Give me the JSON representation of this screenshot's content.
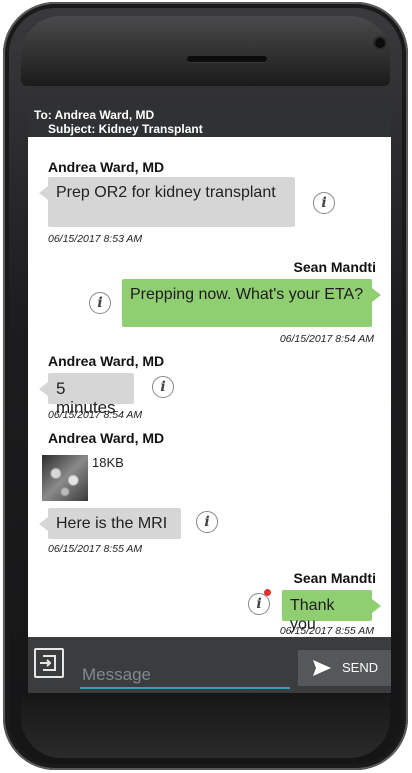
{
  "header": {
    "to": "To: Andrea Ward, MD",
    "subject": "Subject: Kidney Transplant"
  },
  "messages": [
    {
      "sender": "Andrea Ward, MD",
      "text": "Prep OR2 for kidney transplant",
      "time": "06/15/2017 8:53 AM",
      "direction": "incoming"
    },
    {
      "sender": "Sean Mandti",
      "text": "Prepping now. What's your ETA?",
      "time": "06/15/2017 8:54 AM",
      "direction": "outgoing"
    },
    {
      "sender": "Andrea Ward, MD",
      "text": "5 minutes",
      "time": "06/15/2017 8:54 AM",
      "direction": "incoming"
    },
    {
      "sender": "Andrea Ward, MD",
      "attachment_size": "18KB",
      "text": "Here is the MRI",
      "time": "06/15/2017 8:55 AM",
      "direction": "incoming"
    },
    {
      "sender": "Sean Mandti",
      "text": "Thank you",
      "time": "06/15/2017 8:55 AM",
      "direction": "outgoing"
    }
  ],
  "info_icon": "i",
  "composer": {
    "placeholder": "Message",
    "send_label": "SEND"
  },
  "colors": {
    "incoming_bubble": "#d6d6d6",
    "outgoing_bubble": "#90ce72",
    "header_bg": "#2f3133",
    "accent_underline": "#3a9fb0",
    "alert": "#e53030"
  }
}
